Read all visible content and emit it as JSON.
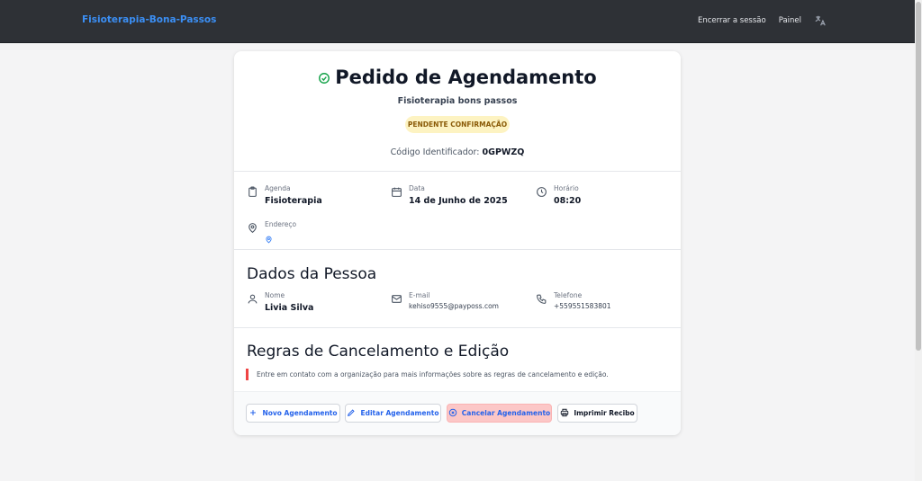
{
  "navbar": {
    "brand": "Fisioterapia-Bona-Passos",
    "logout": "Encerrar a sessão",
    "panel": "Painel",
    "language_icon": "translate-icon"
  },
  "header": {
    "title": "Pedido de Agendamento",
    "organization": "Fisioterapia bons passos",
    "status": "PENDENTE CONFIRMAÇÃO",
    "code_label": "Código Identificador:",
    "code": "0GPWZQ"
  },
  "booking": {
    "agenda_label": "Agenda",
    "agenda_value": "Fisioterapia",
    "date_label": "Data",
    "date_value": "14 de Junho de 2025",
    "time_label": "Horário",
    "time_value": "08:20",
    "address_label": "Endereço"
  },
  "person": {
    "section_title": "Dados da Pessoa",
    "name_label": "Nome",
    "name_value": "Livia Silva",
    "email_label": "E-mail",
    "email_value": "kehiso9555@payposs.com",
    "phone_label": "Telefone",
    "phone_value": "+559551583801"
  },
  "rules": {
    "section_title": "Regras de Cancelamento e Edição",
    "note": "Entre em contato com a organização para mais informações sobre as regras de cancelamento e edição."
  },
  "actions": {
    "new": "Novo Agendamento",
    "edit": "Editar Agendamento",
    "cancel": "Cancelar Agendamento",
    "print": "Imprimir Recibo"
  },
  "colors": {
    "navbar_bg": "#2e3136",
    "brand": "#3b8ff5",
    "status_bg": "#fdf3c2",
    "accent": "#2563eb",
    "danger_bg": "#fcc7c7",
    "success": "#16a34a"
  }
}
